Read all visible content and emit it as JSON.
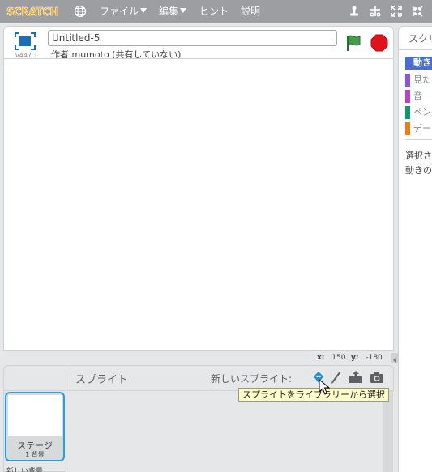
{
  "menubar": {
    "logo": "SCRATCH",
    "items": [
      {
        "label": "ファイル"
      },
      {
        "label": "編集"
      },
      {
        "label": "ヒント"
      },
      {
        "label": "説明"
      }
    ]
  },
  "stage_header": {
    "version": "v447.1",
    "title_value": "Untitled-5",
    "author": "作者 mumoto (共有していない)"
  },
  "coords": {
    "x_label": "x:",
    "x_value": "150",
    "y_label": "y:",
    "y_value": "-180"
  },
  "sprite_pane": {
    "sprites_label": "スプライト",
    "new_sprite_label": "新しいスプライト:",
    "tooltip": "スプライトをライブラリーから選択",
    "stage_name": "ステージ",
    "stage_backdrops": "1 背景",
    "new_backdrop": "新しい背景"
  },
  "scripts_panel": {
    "tab_label": "スクリプト",
    "categories": [
      {
        "label": "動き",
        "color": "#4a6cd4",
        "active": true
      },
      {
        "label": "見た目",
        "color": "#8a55d7"
      },
      {
        "label": "音",
        "color": "#bb42c3"
      },
      {
        "label": "ペン",
        "color": "#0e9a6c"
      },
      {
        "label": "データ",
        "color": "#ee7d16"
      }
    ],
    "hint_line1": "選択さ",
    "hint_line2": "動きの"
  },
  "colors": {
    "menubar": "#9c9ea2",
    "logo_orange": "#f4a41d",
    "flag_green": "#40a147",
    "stop_red": "#e0131c",
    "selected_blue": "#25a0d8"
  }
}
